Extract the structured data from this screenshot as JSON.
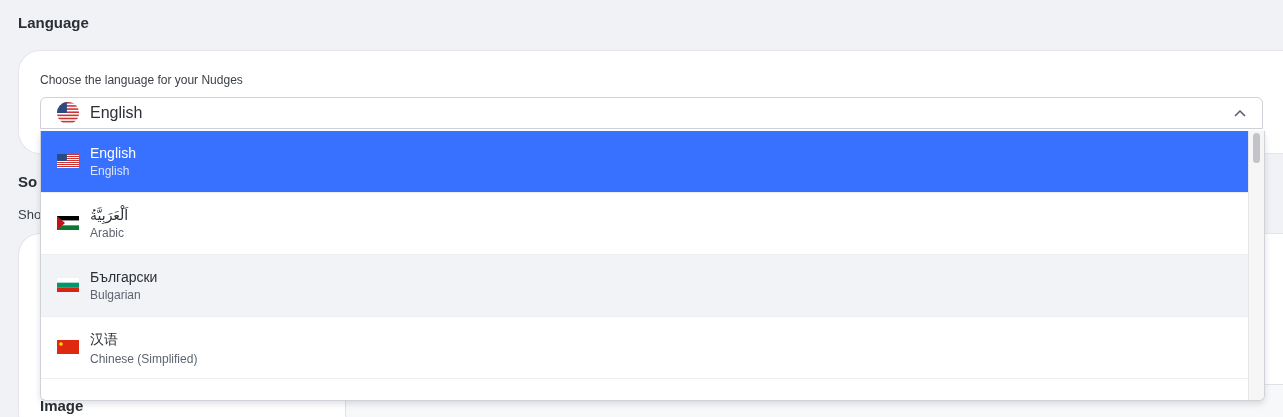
{
  "language_section": {
    "heading": "Language",
    "label": "Choose the language for your Nudges",
    "select": {
      "value": "English",
      "kind": "us",
      "expanded": true
    }
  },
  "next_section": {
    "heading": "So",
    "description": "Sho",
    "field_label": "Image"
  },
  "options": [
    {
      "name": "English",
      "english": "English",
      "kind": "us",
      "selected": true,
      "hovered": false
    },
    {
      "name": "اَلْعَرَبِيَّةُ",
      "english": "Arabic",
      "kind": "ar",
      "selected": false,
      "hovered": false
    },
    {
      "name": "Български",
      "english": "Bulgarian",
      "kind": "bg",
      "selected": false,
      "hovered": true
    },
    {
      "name": "汉语",
      "english": "Chinese (Simplified)",
      "kind": "cn",
      "selected": false,
      "hovered": false
    }
  ]
}
